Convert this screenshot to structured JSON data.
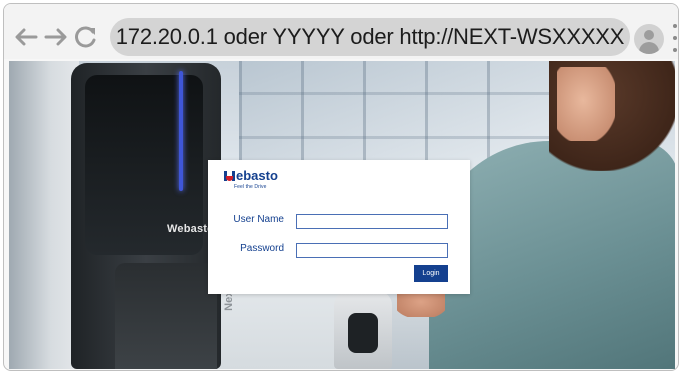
{
  "browser": {
    "url_text": "172.20.0.1 oder YYYYY oder http://NEXT-WSXXXXX",
    "back_icon": "arrow-left-icon",
    "forward_icon": "arrow-right-icon",
    "reload_icon": "reload-icon",
    "profile_icon": "user-avatar-icon",
    "menu_icon": "kebab-menu-icon"
  },
  "background": {
    "charger_logo": "Webasto",
    "charger_side_text": "Next"
  },
  "login": {
    "brand_name": "ebasto",
    "brand_tagline": "Feel the Drive",
    "username_label": "User Name",
    "username_value": "",
    "password_label": "Password",
    "password_value": "",
    "login_button": "Login"
  },
  "colors": {
    "brand_blue": "#14408f",
    "brand_red": "#d3202a",
    "urlbar_bg": "#d4d4d4"
  }
}
